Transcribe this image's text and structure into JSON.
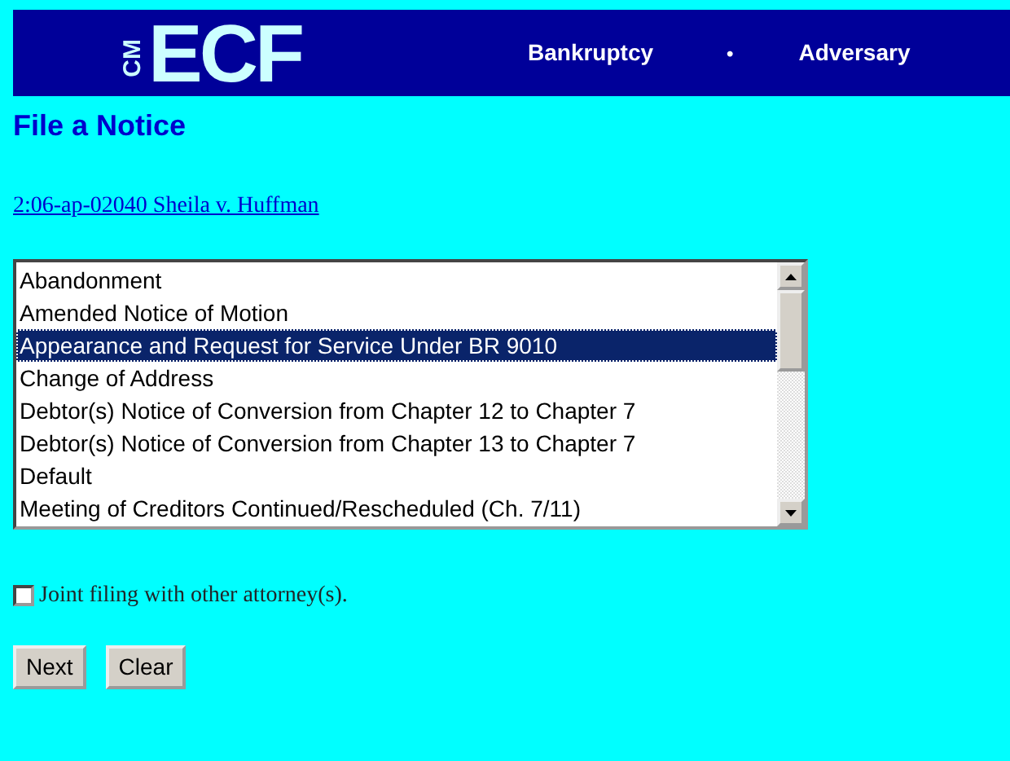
{
  "header": {
    "logo_small": "CM",
    "logo": "ECF",
    "nav": [
      {
        "kind": "link",
        "label": "Bankruptcy"
      },
      {
        "kind": "separator",
        "label": "•"
      },
      {
        "kind": "link",
        "label": "Adversary"
      }
    ]
  },
  "title": "File a Notice",
  "case_link": "2:06-ap-02040 Sheila v. Huffman",
  "events": [
    {
      "label": "Abandonment",
      "selected": false
    },
    {
      "label": "Amended Notice of Motion",
      "selected": false
    },
    {
      "label": "Appearance and Request for Service Under BR 9010",
      "selected": true
    },
    {
      "label": "Change of Address",
      "selected": false
    },
    {
      "label": "Debtor(s) Notice of Conversion from Chapter 12 to Chapter 7",
      "selected": false
    },
    {
      "label": "Debtor(s) Notice of Conversion from Chapter 13 to Chapter 7",
      "selected": false
    },
    {
      "label": "Default",
      "selected": false
    },
    {
      "label": "Meeting of Creditors Continued/Rescheduled (Ch. 7/11)",
      "selected": false
    }
  ],
  "joint_filing": {
    "label": "Joint filing with other attorney(s).",
    "checked": false
  },
  "buttons": [
    "Next",
    "Clear"
  ]
}
